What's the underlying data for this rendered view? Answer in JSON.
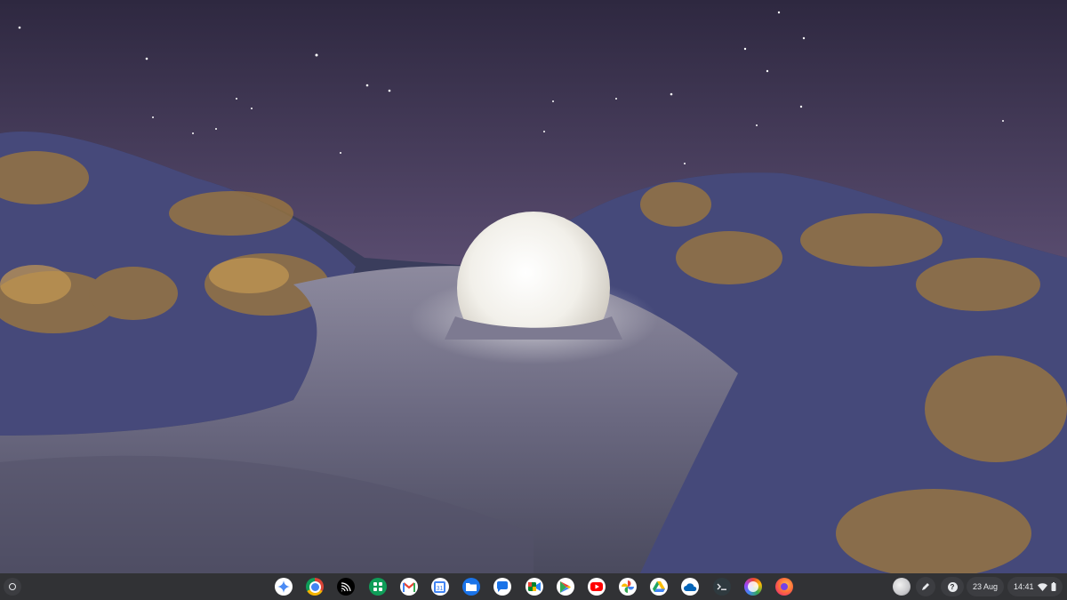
{
  "wallpaper": {
    "description_icon": "moon-dune-wallpaper"
  },
  "shelf": {
    "launcher_icon": "launcher-icon",
    "apps": [
      {
        "name": "gemini",
        "icon": "gemini-icon",
        "color": "#4285f4"
      },
      {
        "name": "chrome",
        "icon": "chrome-icon",
        "color": "#db4437"
      },
      {
        "name": "cast",
        "icon": "cast-icon",
        "color": "#000000"
      },
      {
        "name": "app-grid",
        "icon": "app-grid-icon",
        "color": "#0f9d58"
      },
      {
        "name": "gmail",
        "icon": "gmail-icon",
        "color": "#ea4335"
      },
      {
        "name": "calendar",
        "icon": "calendar-icon",
        "color": "#4285f4"
      },
      {
        "name": "files",
        "icon": "files-icon",
        "color": "#1a73e8"
      },
      {
        "name": "messages",
        "icon": "messages-icon",
        "color": "#1a73e8"
      },
      {
        "name": "meet",
        "icon": "meet-icon",
        "color": "#00832d"
      },
      {
        "name": "play-store",
        "icon": "play-store-icon",
        "color": "#34a853"
      },
      {
        "name": "youtube",
        "icon": "youtube-icon",
        "color": "#ff0000"
      },
      {
        "name": "photos",
        "icon": "photos-icon",
        "color": "#fbbc04"
      },
      {
        "name": "drive",
        "icon": "drive-icon",
        "color": "#1fa463"
      },
      {
        "name": "onedrive",
        "icon": "onedrive-icon",
        "color": "#0364b8"
      },
      {
        "name": "terminal",
        "icon": "terminal-icon",
        "color": "#2f3a3f"
      },
      {
        "name": "app-15",
        "icon": "colorful-app-icon",
        "color": "#a142f4"
      },
      {
        "name": "firefox",
        "icon": "firefox-icon",
        "color": "#ff7139"
      }
    ]
  },
  "tray": {
    "pen_icon": "stylus-icon",
    "help_label": "?",
    "date": "23 Aug",
    "time": "14:41",
    "wifi_icon": "wifi-icon",
    "battery_icon": "battery-icon"
  }
}
